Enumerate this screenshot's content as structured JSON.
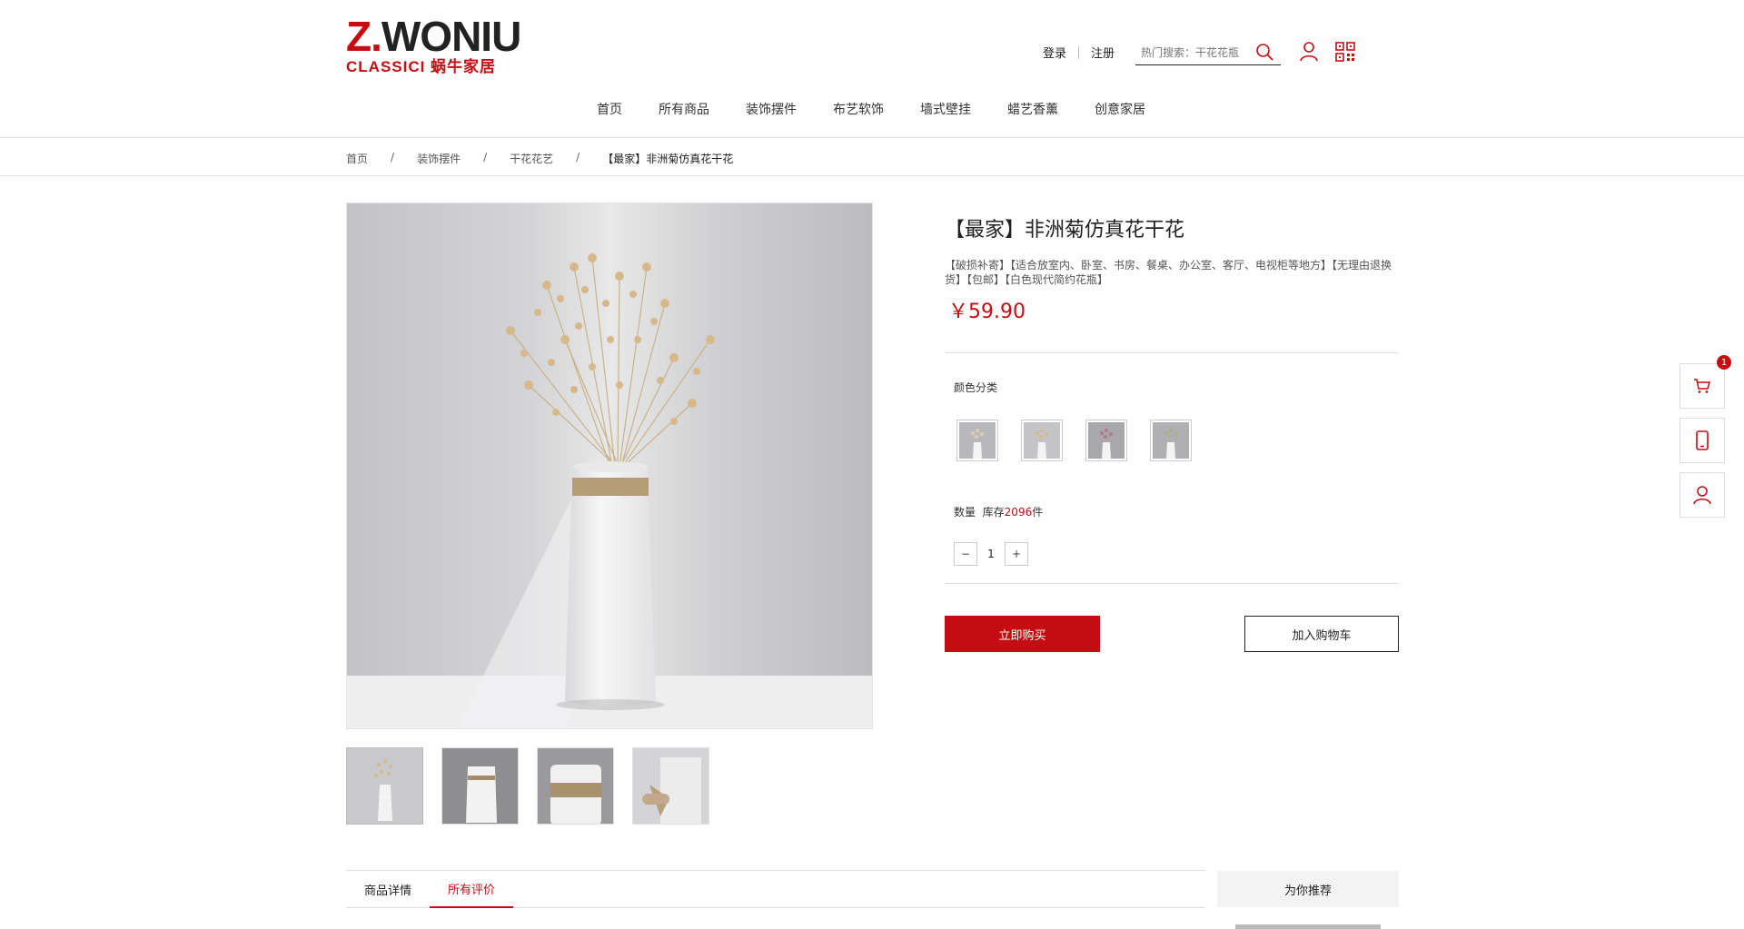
{
  "brand": {
    "logo_main_z": "Z.",
    "logo_main_rest": "WONIU",
    "logo_sub": "CLASSICI 蜗牛家居"
  },
  "header": {
    "login": "登录",
    "register": "注册",
    "search_placeholder": "热门搜索：干花花瓶",
    "icons": [
      "search-icon",
      "user-icon",
      "qrcode-icon"
    ]
  },
  "nav": [
    "首页",
    "所有商品",
    "装饰摆件",
    "布艺软饰",
    "墙式壁挂",
    "蜡艺香薰",
    "创意家居"
  ],
  "breadcrumb": [
    "首页",
    "装饰摆件",
    "干花花艺",
    "【最家】非洲菊仿真花干花"
  ],
  "product": {
    "title": "【最家】非洲菊仿真花干花",
    "description": "【破损补寄】【适合放室内、卧室、书房、餐桌、办公室、客厅、电视柜等地方】【无理由退换货】【包邮】【白色现代简约花瓶】",
    "price": "￥59.90",
    "color_label": "颜色分类",
    "qty_label": "数量",
    "stock_prefix": "库存",
    "stock_count": "2096",
    "stock_suffix": "件",
    "quantity": "1",
    "minus": "−",
    "plus": "+",
    "buy_now": "立即购买",
    "add_to_cart": "加入购物车"
  },
  "side_toolbar": {
    "cart_badge": "1",
    "icons": [
      "cart-icon",
      "mobile-icon",
      "user-icon"
    ]
  },
  "tabs": [
    "商品详情",
    "所有评价"
  ],
  "active_tab": "所有评价",
  "recommend_title": "为你推荐",
  "colors": {
    "accent": "#c40d13",
    "text": "#222222",
    "border": "#dddddd"
  }
}
